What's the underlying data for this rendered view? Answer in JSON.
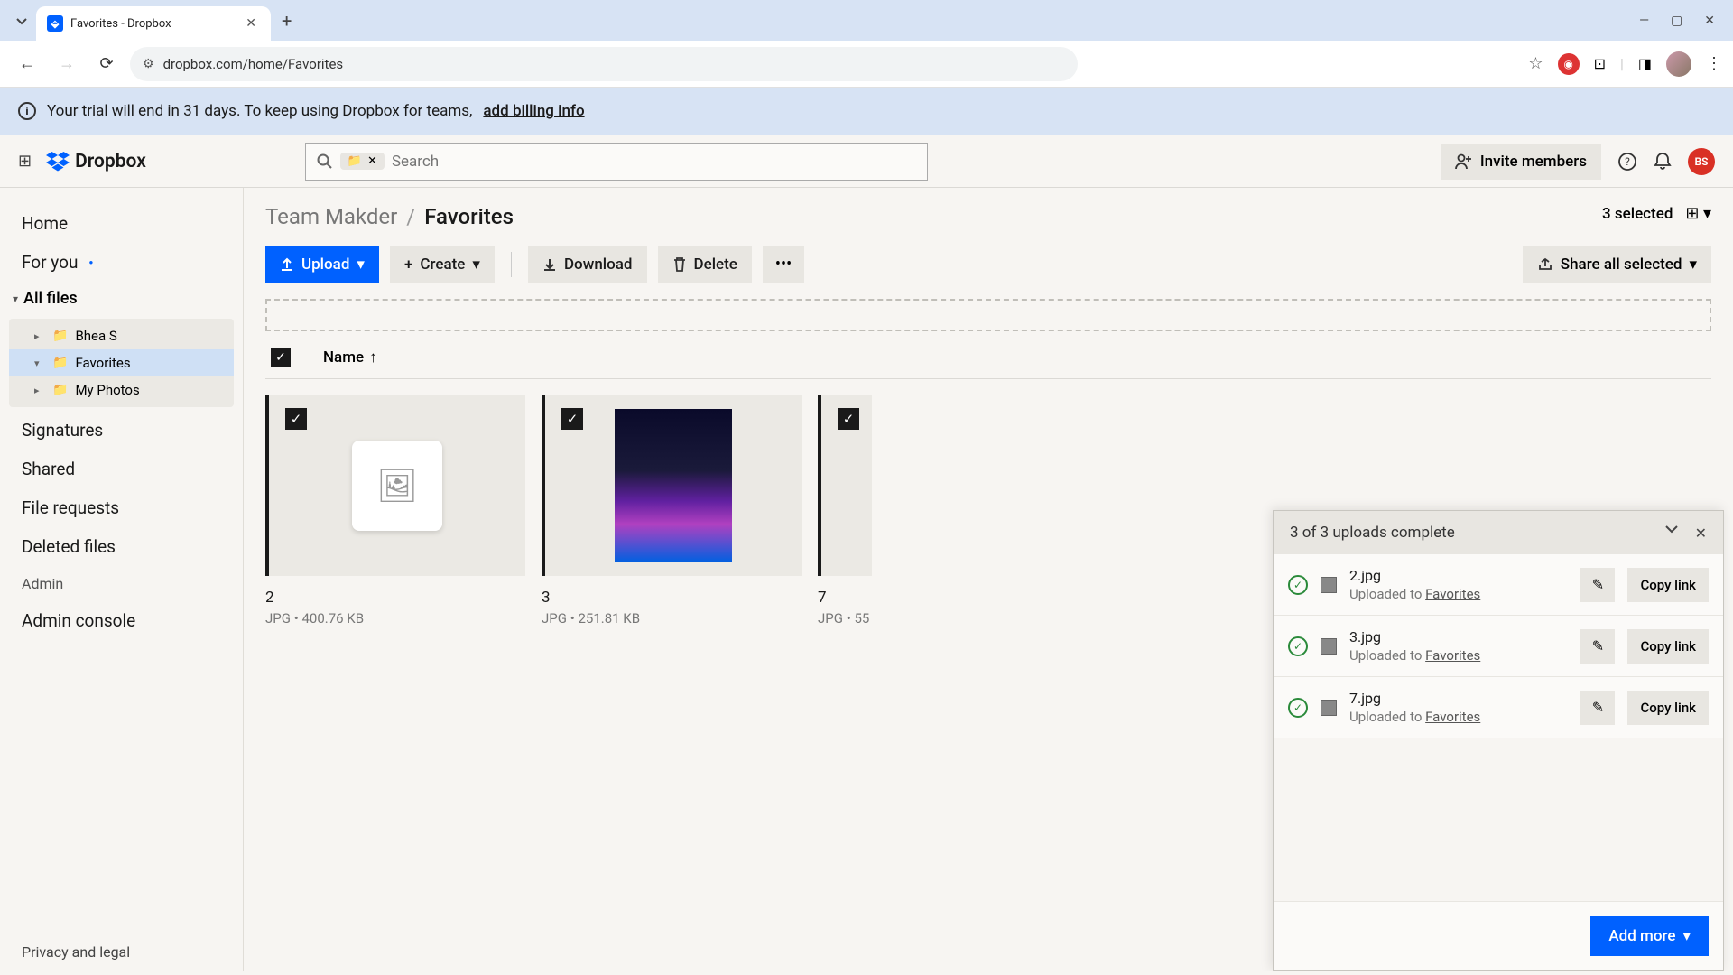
{
  "browser": {
    "tab_title": "Favorites - Dropbox",
    "url": "dropbox.com/home/Favorites"
  },
  "trial": {
    "text": "Your trial will end in 31 days. To keep using Dropbox for teams,",
    "link": "add billing info"
  },
  "header": {
    "logo_text": "Dropbox",
    "search_placeholder": "Search",
    "invite": "Invite members",
    "user_initials": "BS"
  },
  "sidebar": {
    "home": "Home",
    "for_you": "For you",
    "all_files": "All files",
    "tree": [
      {
        "label": "Bhea S",
        "active": false
      },
      {
        "label": "Favorites",
        "active": true
      },
      {
        "label": "My Photos",
        "active": false
      }
    ],
    "signatures": "Signatures",
    "shared": "Shared",
    "file_requests": "File requests",
    "deleted": "Deleted files",
    "admin": "Admin",
    "admin_console": "Admin console",
    "privacy": "Privacy and legal"
  },
  "breadcrumb": {
    "root": "Team Makder",
    "current": "Favorites"
  },
  "selected_text": "3 selected",
  "actions": {
    "upload": "Upload",
    "create": "Create",
    "download": "Download",
    "delete": "Delete",
    "share_all": "Share all selected"
  },
  "list": {
    "col_name": "Name"
  },
  "files": [
    {
      "name": "2",
      "type": "JPG",
      "size": "400.76 KB",
      "has_preview": false
    },
    {
      "name": "3",
      "type": "JPG",
      "size": "251.81 KB",
      "has_preview": true
    },
    {
      "name": "7",
      "type": "JPG",
      "size": "55",
      "has_preview": false
    }
  ],
  "uploads": {
    "title": "3 of 3 uploads complete",
    "items": [
      {
        "name": "2.jpg",
        "dest_prefix": "Uploaded to ",
        "dest": "Favorites"
      },
      {
        "name": "3.jpg",
        "dest_prefix": "Uploaded to ",
        "dest": "Favorites"
      },
      {
        "name": "7.jpg",
        "dest_prefix": "Uploaded to ",
        "dest": "Favorites"
      }
    ],
    "edit_label": "✎",
    "copy_label": "Copy link",
    "add_more": "Add more"
  }
}
